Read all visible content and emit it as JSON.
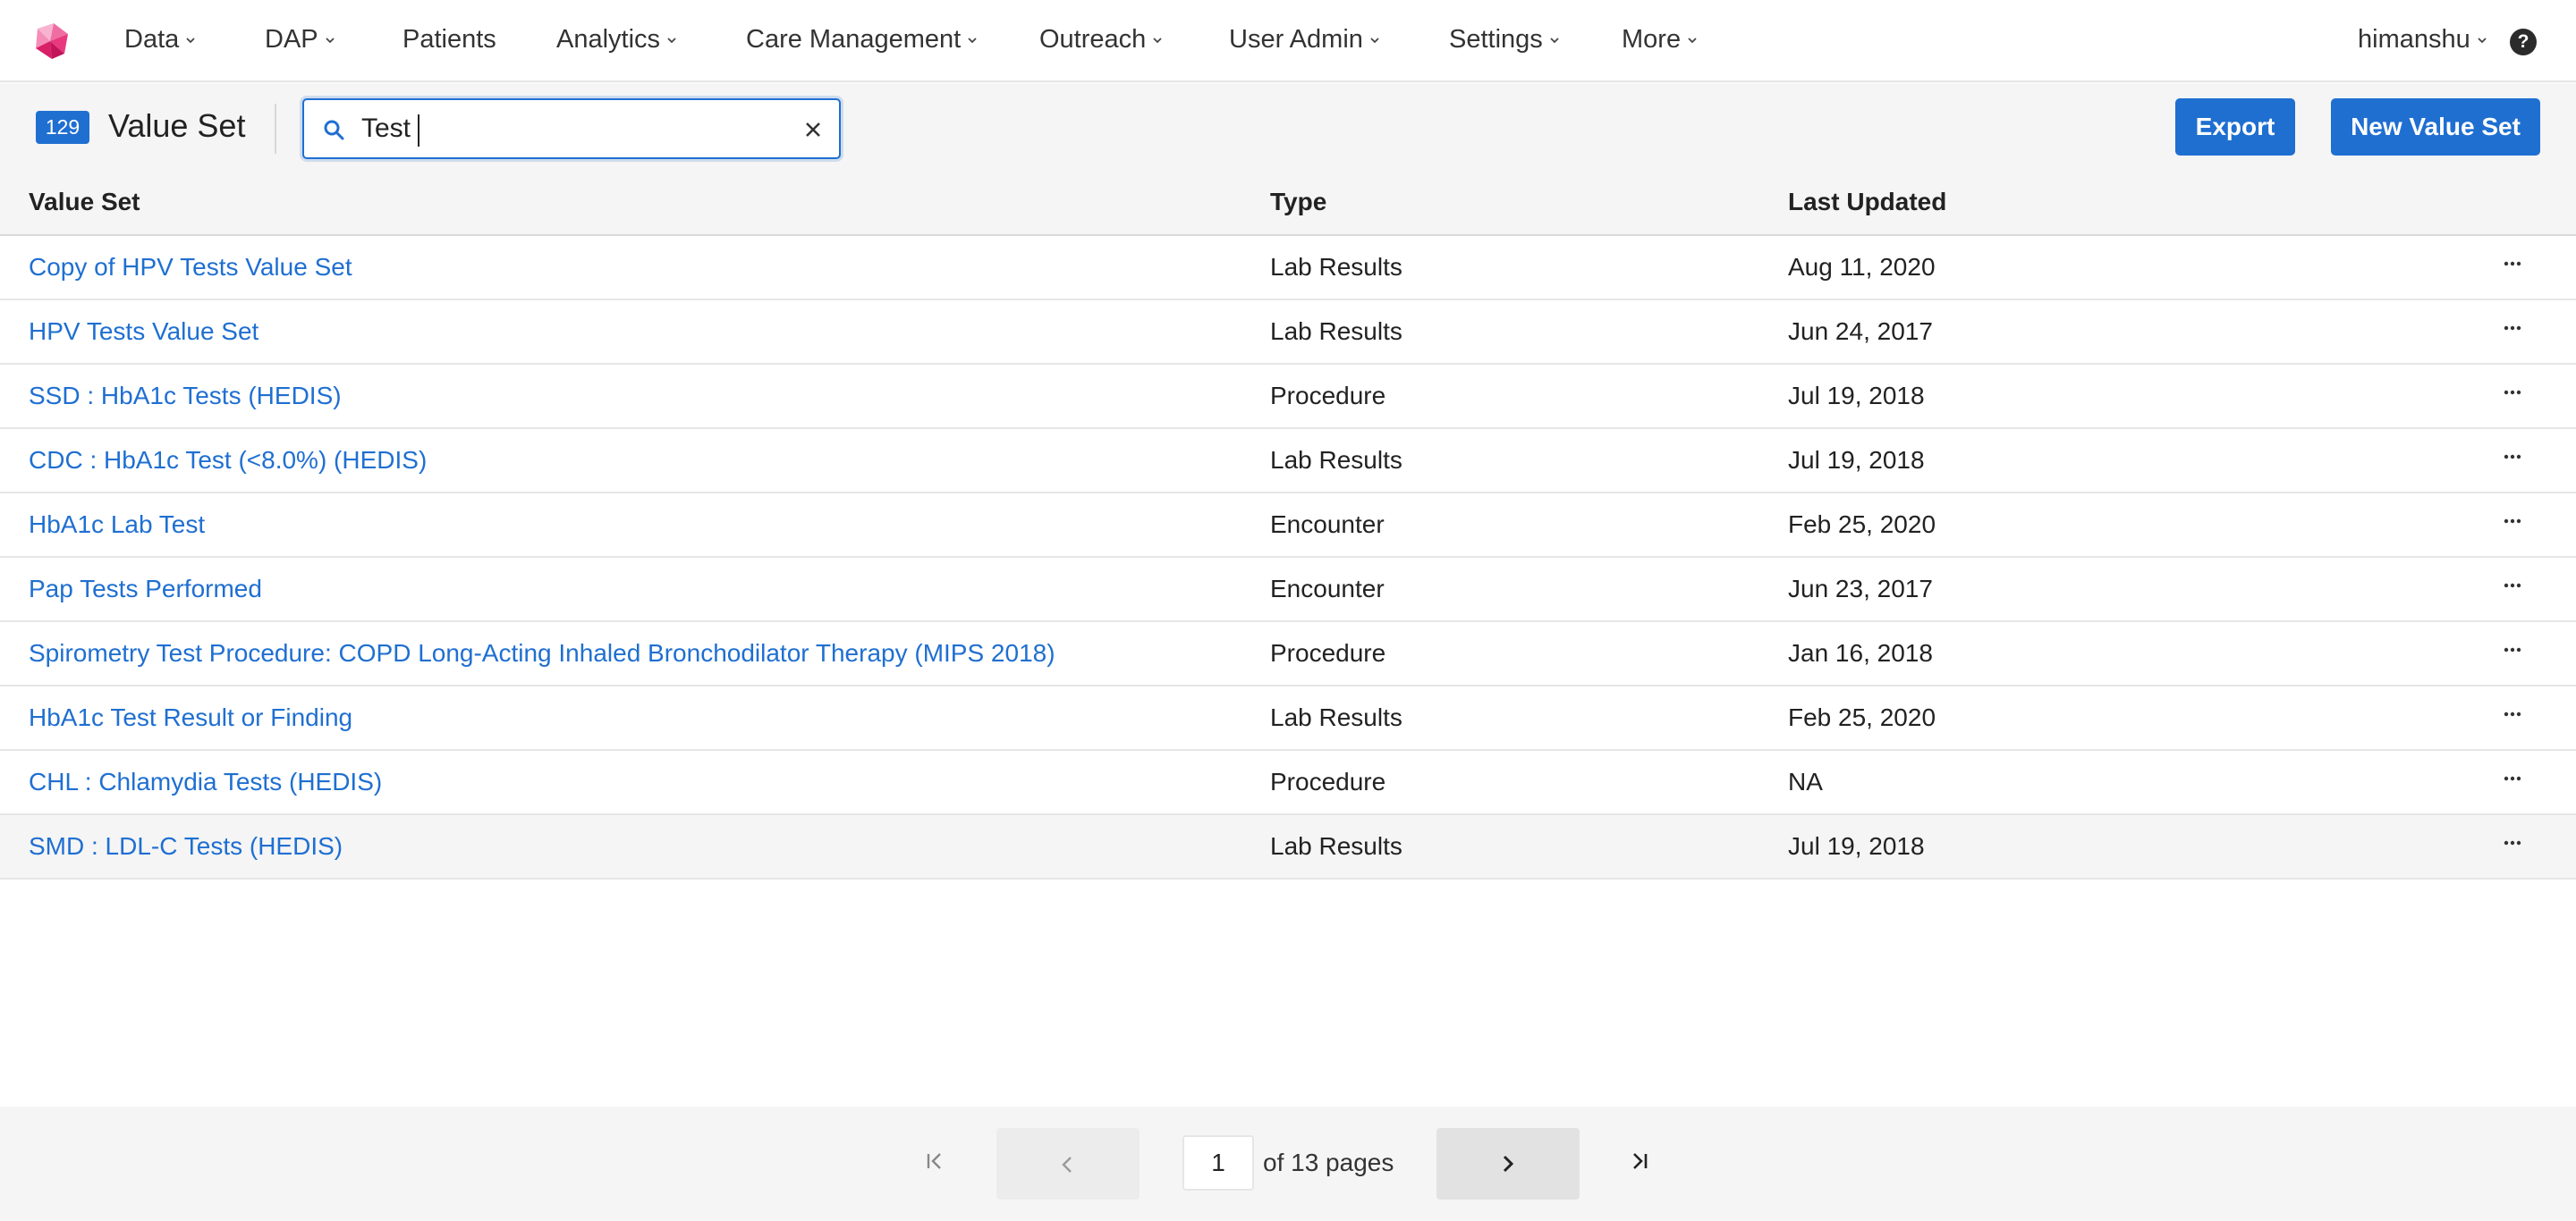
{
  "nav": {
    "items": [
      {
        "label": "Data",
        "dropdown": true
      },
      {
        "label": "DAP",
        "dropdown": true
      },
      {
        "label": "Patients",
        "dropdown": false
      },
      {
        "label": "Analytics",
        "dropdown": true
      },
      {
        "label": "Care Management",
        "dropdown": true
      },
      {
        "label": "Outreach",
        "dropdown": true
      },
      {
        "label": "User Admin",
        "dropdown": true
      },
      {
        "label": "Settings",
        "dropdown": true
      },
      {
        "label": "More",
        "dropdown": true
      }
    ],
    "user": "himanshu",
    "help_icon": "help-icon"
  },
  "header": {
    "count": "129",
    "title": "Value Set",
    "search": {
      "value": "Test"
    },
    "export_label": "Export",
    "new_label": "New Value Set"
  },
  "table": {
    "columns": [
      "Value Set",
      "Type",
      "Last Updated"
    ],
    "rows": [
      {
        "name": "Copy of HPV Tests Value Set",
        "type": "Lab Results",
        "updated": "Aug 11, 2020"
      },
      {
        "name": "HPV Tests Value Set",
        "type": "Lab Results",
        "updated": "Jun 24, 2017"
      },
      {
        "name": "SSD : HbA1c Tests (HEDIS)",
        "type": "Procedure",
        "updated": "Jul 19, 2018"
      },
      {
        "name": "CDC : HbA1c Test (<8.0%) (HEDIS)",
        "type": "Lab Results",
        "updated": "Jul 19, 2018"
      },
      {
        "name": "HbA1c Lab Test",
        "type": "Encounter",
        "updated": "Feb 25, 2020"
      },
      {
        "name": "Pap Tests Performed",
        "type": "Encounter",
        "updated": "Jun 23, 2017"
      },
      {
        "name": "Spirometry Test Procedure: COPD Long-Acting Inhaled Bronchodilator Therapy (MIPS 2018)",
        "type": "Procedure",
        "updated": "Jan 16, 2018"
      },
      {
        "name": "HbA1c Test Result or Finding",
        "type": "Lab Results",
        "updated": "Feb 25, 2020"
      },
      {
        "name": "CHL : Chlamydia Tests (HEDIS)",
        "type": "Procedure",
        "updated": "NA"
      },
      {
        "name": "SMD : LDL-C Tests (HEDIS)",
        "type": "Lab Results",
        "updated": "Jul 19, 2018"
      }
    ]
  },
  "pagination": {
    "current_page": "1",
    "total_label": "of 13 pages"
  },
  "colors": {
    "accent": "#1f6fd1",
    "logo_pink": "#e8397d",
    "header_bg": "#f5f5f5"
  }
}
